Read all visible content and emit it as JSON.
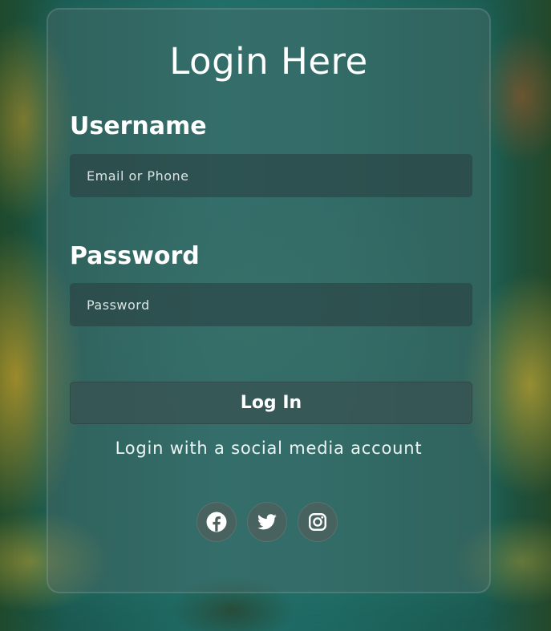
{
  "form": {
    "title": "Login Here",
    "username_label": "Username",
    "username_placeholder": "Email or Phone",
    "username_value": "",
    "password_label": "Password",
    "password_placeholder": "Password",
    "password_value": "",
    "login_button": "Log In",
    "social_text": "Login with a social media account"
  },
  "social": [
    {
      "icon": "facebook-icon"
    },
    {
      "icon": "twitter-icon"
    },
    {
      "icon": "instagram-icon"
    }
  ],
  "colors": {
    "text": "#ffffff",
    "card": "#4b6e6c",
    "background": "#1f6963"
  }
}
